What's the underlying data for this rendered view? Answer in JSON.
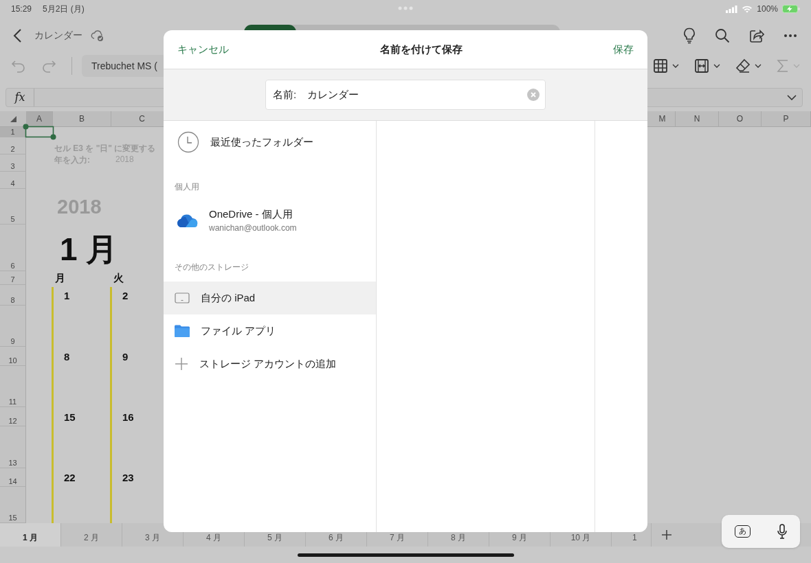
{
  "status_bar": {
    "time": "15:29",
    "date": "5月2日 (月)",
    "battery": "100%"
  },
  "title_bar": {
    "document": "カレンダー"
  },
  "toolbar": {
    "font": "Trebuchet MS ("
  },
  "formula_bar": {
    "label": "fx"
  },
  "sheet": {
    "column_headers": [
      "A",
      "B",
      "C",
      "M",
      "N",
      "O",
      "P"
    ],
    "row_headers": [
      "1",
      "2",
      "3",
      "4",
      "5",
      "6",
      "7",
      "8",
      "9",
      "10",
      "11",
      "12",
      "13",
      "14",
      "15"
    ],
    "note": "セル E3 を \"日\" に変更する",
    "year_label": "年を入力:",
    "year_value": "2018",
    "year_title": "2018",
    "month_title": "1 月",
    "weekdays": [
      "月",
      "火"
    ],
    "weeks": [
      [
        "1",
        "2"
      ],
      [
        "8",
        "9"
      ],
      [
        "15",
        "16"
      ],
      [
        "22",
        "23"
      ]
    ]
  },
  "sheet_tabs": [
    {
      "label": "1 月",
      "selected": true
    },
    {
      "label": "2 月",
      "selected": false
    },
    {
      "label": "3 月",
      "selected": false
    },
    {
      "label": "4 月",
      "selected": false
    },
    {
      "label": "5 月",
      "selected": false
    },
    {
      "label": "6 月",
      "selected": false
    },
    {
      "label": "7 月",
      "selected": false
    },
    {
      "label": "8 月",
      "selected": false
    },
    {
      "label": "9 月",
      "selected": false
    },
    {
      "label": "10 月",
      "selected": false
    },
    {
      "label": "1",
      "selected": false
    }
  ],
  "keyboard_bar": {
    "ime_key": "あ"
  },
  "dialog": {
    "cancel": "キャンセル",
    "title": "名前を付けて保存",
    "save": "保存",
    "name_label": "名前:",
    "name_value": "カレンダー",
    "locations": [
      {
        "kind": "recent",
        "label": "最近使ったフォルダー",
        "selected": false
      },
      {
        "kind": "section",
        "label": "個人用"
      },
      {
        "kind": "onedrive",
        "label": "OneDrive - 個人用",
        "detail": "wanichan@outlook.com",
        "selected": false
      },
      {
        "kind": "section",
        "label": "その他のストレージ"
      },
      {
        "kind": "device",
        "label": "自分の iPad",
        "selected": true
      },
      {
        "kind": "files",
        "label": "ファイル アプリ",
        "selected": false
      },
      {
        "kind": "add",
        "label": "ストレージ アカウントの追加",
        "selected": false
      }
    ]
  }
}
